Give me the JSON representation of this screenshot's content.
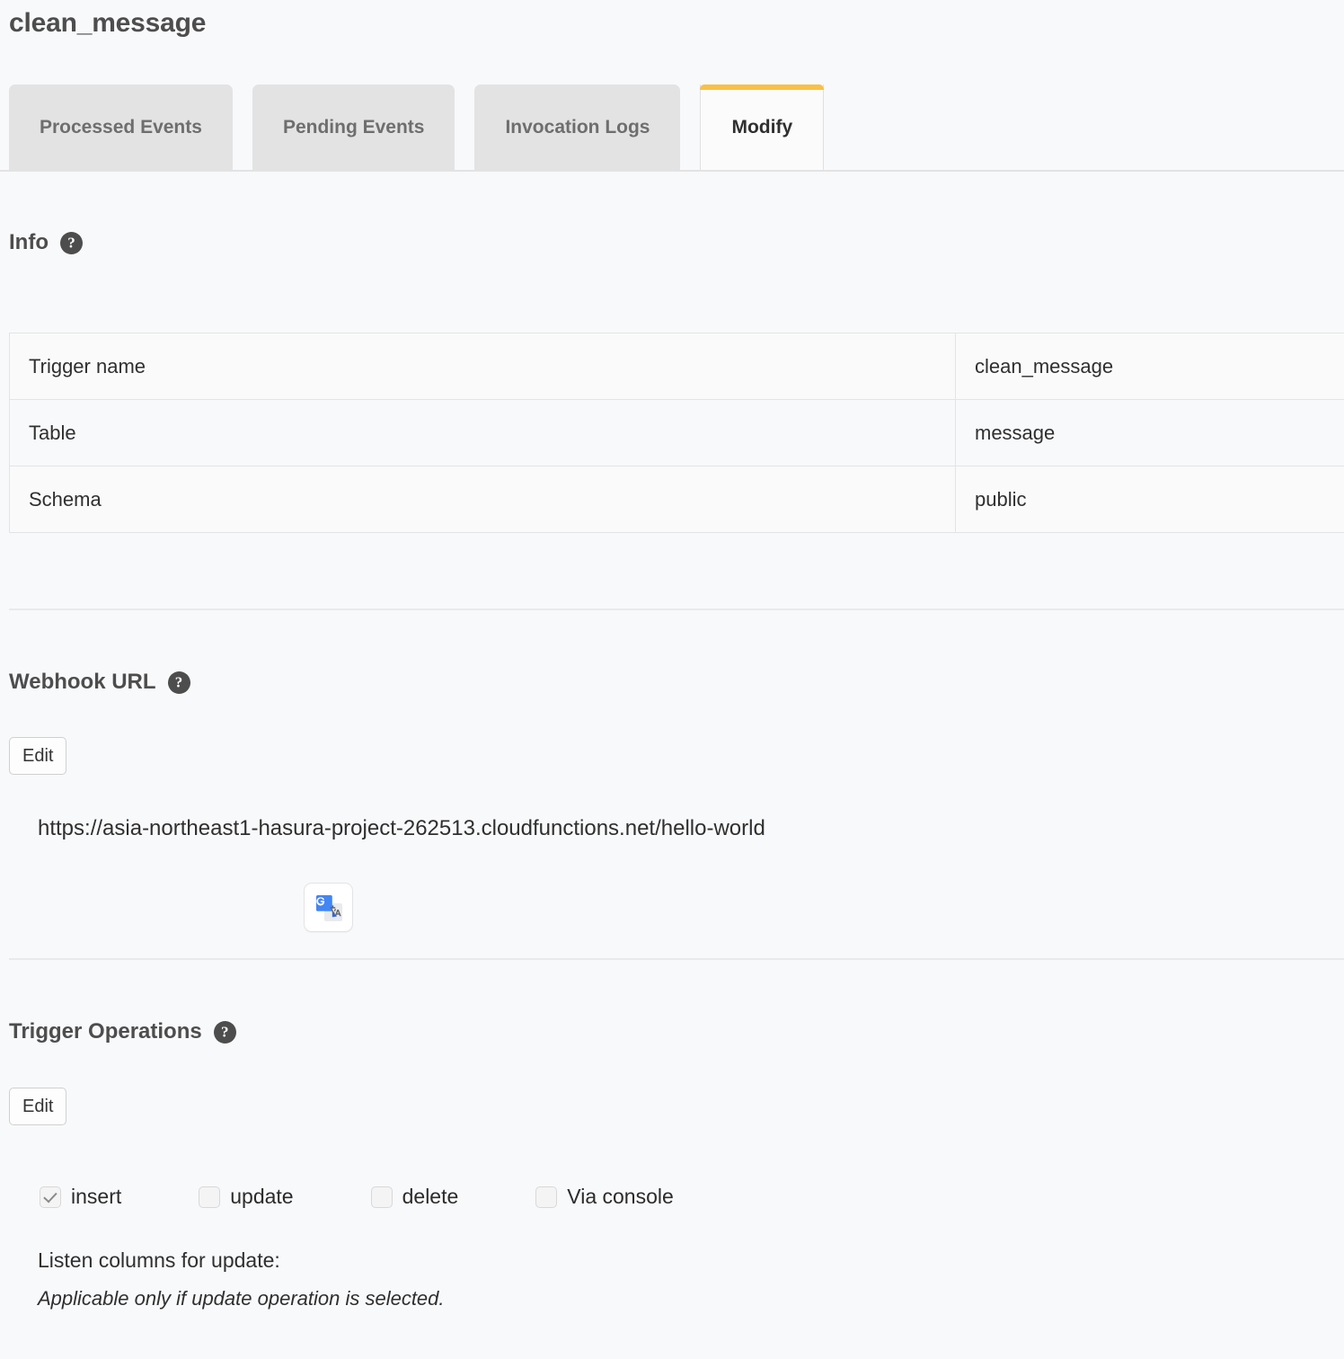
{
  "page": {
    "title": "clean_message"
  },
  "tabs": [
    {
      "label": "Processed Events",
      "active": false
    },
    {
      "label": "Pending Events",
      "active": false
    },
    {
      "label": "Invocation Logs",
      "active": false
    },
    {
      "label": "Modify",
      "active": true
    }
  ],
  "info": {
    "heading": "Info",
    "help_icon": "help-circle-icon",
    "rows": [
      {
        "key": "Trigger name",
        "value": "clean_message"
      },
      {
        "key": "Table",
        "value": "message"
      },
      {
        "key": "Schema",
        "value": "public"
      }
    ]
  },
  "webhook": {
    "heading": "Webhook URL",
    "help_icon": "help-circle-icon",
    "edit_label": "Edit",
    "url": "https://asia-northeast1-hasura-project-262513.cloudfunctions.net/hello-world",
    "extension_icon": "google-translate-icon"
  },
  "trigger_operations": {
    "heading": "Trigger Operations",
    "help_icon": "help-circle-icon",
    "edit_label": "Edit",
    "operations": [
      {
        "label": "insert",
        "checked": true
      },
      {
        "label": "update",
        "checked": false
      },
      {
        "label": "delete",
        "checked": false
      },
      {
        "label": "Via console",
        "checked": false
      }
    ],
    "listen_columns_label": "Listen columns for update:",
    "listen_columns_note": "Applicable only if update operation is selected."
  },
  "colors": {
    "background": "#f8f9fb",
    "active_tab_accent": "#f8c146",
    "inactive_tab_bg": "#e3e3e3",
    "heading_text": "#4d4d4d",
    "border": "#e2e4e6"
  }
}
